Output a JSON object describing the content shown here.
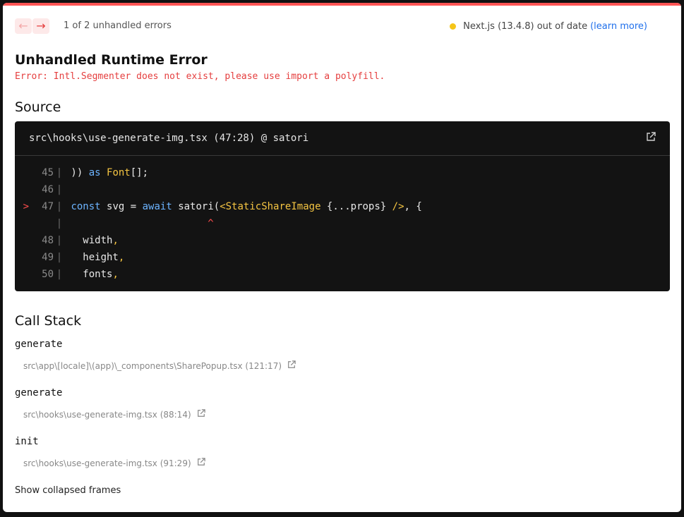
{
  "nav": {
    "prev_icon": "arrow-left-icon",
    "next_icon": "arrow-right-icon",
    "prev_glyph": "←",
    "next_glyph": "→"
  },
  "error_count": "1 of 2 unhandled errors",
  "version": {
    "text": "Next.js (13.4.8) out of date",
    "link": "(learn more)",
    "dot_color": "#f5c518"
  },
  "title": "Unhandled Runtime Error",
  "error_message": "Error: Intl.Segmenter does not exist, please use import a polyfill.",
  "source": {
    "heading": "Source",
    "file": "src\\hooks\\use-generate-img.tsx (47:28) @ satori",
    "external_icon": "external-link-icon",
    "lines": [
      {
        "num": "45",
        "sep": "|",
        "marker": ""
      },
      {
        "num": "46",
        "sep": "|",
        "marker": ""
      },
      {
        "num": "47",
        "sep": "|",
        "marker": ">"
      },
      {
        "num": "",
        "sep": "|",
        "marker": ""
      },
      {
        "num": "48",
        "sep": "|",
        "marker": ""
      },
      {
        "num": "49",
        "sep": "|",
        "marker": ""
      },
      {
        "num": "50",
        "sep": "|",
        "marker": ""
      }
    ],
    "tokens": {
      "l45_a": " )) ",
      "l45_b": "as",
      "l45_c": " ",
      "l45_d": "Font",
      "l45_e": "[];",
      "l47_a": " ",
      "l47_b": "const",
      "l47_c": " svg = ",
      "l47_d": "await",
      "l47_e": " satori(",
      "l47_f": "<StaticShareImage",
      "l47_g": " {...props} ",
      "l47_h": "/>",
      "l47_i": ", {",
      "caret_pad": "                        ",
      "caret": "^",
      "l48": "   width",
      "l49": "   height",
      "l50": "   fonts",
      "comma": ","
    }
  },
  "call_stack": {
    "heading": "Call Stack",
    "frames": [
      {
        "fn": "generate",
        "loc": "src\\app\\[locale]\\(app)\\_components\\SharePopup.tsx (121:17)"
      },
      {
        "fn": "generate",
        "loc": "src\\hooks\\use-generate-img.tsx (88:14)"
      },
      {
        "fn": "init",
        "loc": "src\\hooks\\use-generate-img.tsx (91:29)"
      }
    ]
  },
  "show_collapsed": "Show collapsed frames",
  "colors": {
    "accent": "#ff5555",
    "error": "#e53e3e",
    "link": "#1f6feb"
  }
}
